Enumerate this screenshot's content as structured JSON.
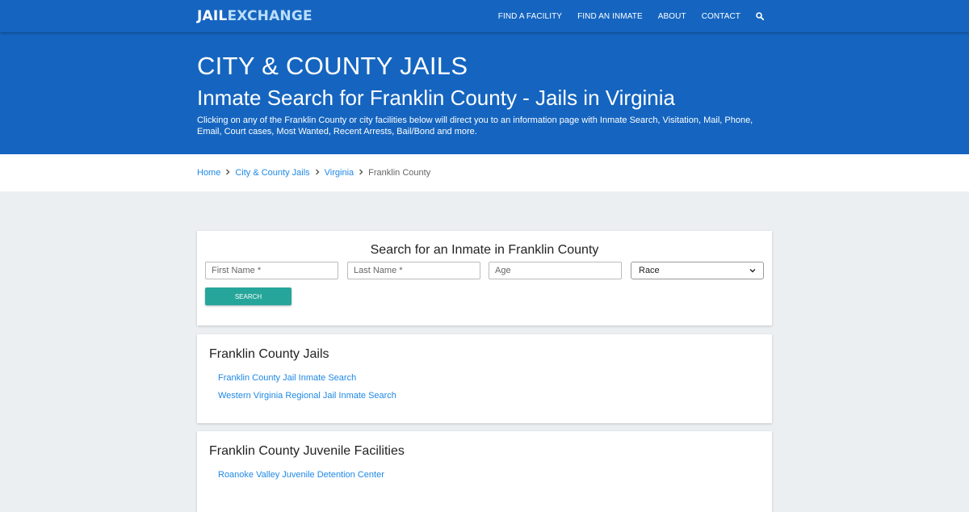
{
  "navbar": {
    "logo": {
      "part1": "JAIL",
      "part2": "EXCHANGE"
    },
    "links": [
      "FIND A FACILITY",
      "FIND AN INMATE",
      "ABOUT",
      "CONTACT"
    ]
  },
  "hero": {
    "title": "CITY & COUNTY JAILS",
    "subtitle": "Inmate Search for Franklin County - Jails in Virginia",
    "description": "Clicking on any of the Franklin County or city facilities below will direct you to an information page with Inmate Search, Visitation, Mail, Phone, Email, Court cases, Most Wanted, Recent Arrests, Bail/Bond and more."
  },
  "breadcrumb": {
    "items": [
      "Home",
      "City & County Jails",
      "Virginia"
    ],
    "current": "Franklin County"
  },
  "search_form": {
    "heading": "Search for an Inmate in Franklin County",
    "first_name_placeholder": "First Name *",
    "last_name_placeholder": "Last Name *",
    "age_placeholder": "Age",
    "race_selected": "Race",
    "button_label": "SEARCH"
  },
  "jails_section": {
    "title": "Franklin County Jails",
    "links": [
      "Franklin County Jail Inmate Search",
      "Western Virginia Regional Jail Inmate Search"
    ]
  },
  "juvenile_section": {
    "title": "Franklin County Juvenile Facilities",
    "links": [
      "Roanoke Valley Juvenile Detention Center"
    ]
  },
  "colors": {
    "primary": "#1565c0",
    "accent_button": "#26a69a",
    "link": "#1e88e5",
    "background": "#eceff1"
  },
  "icons": [
    "search-icon",
    "chevron-right-icon",
    "chevron-down-icon"
  ]
}
